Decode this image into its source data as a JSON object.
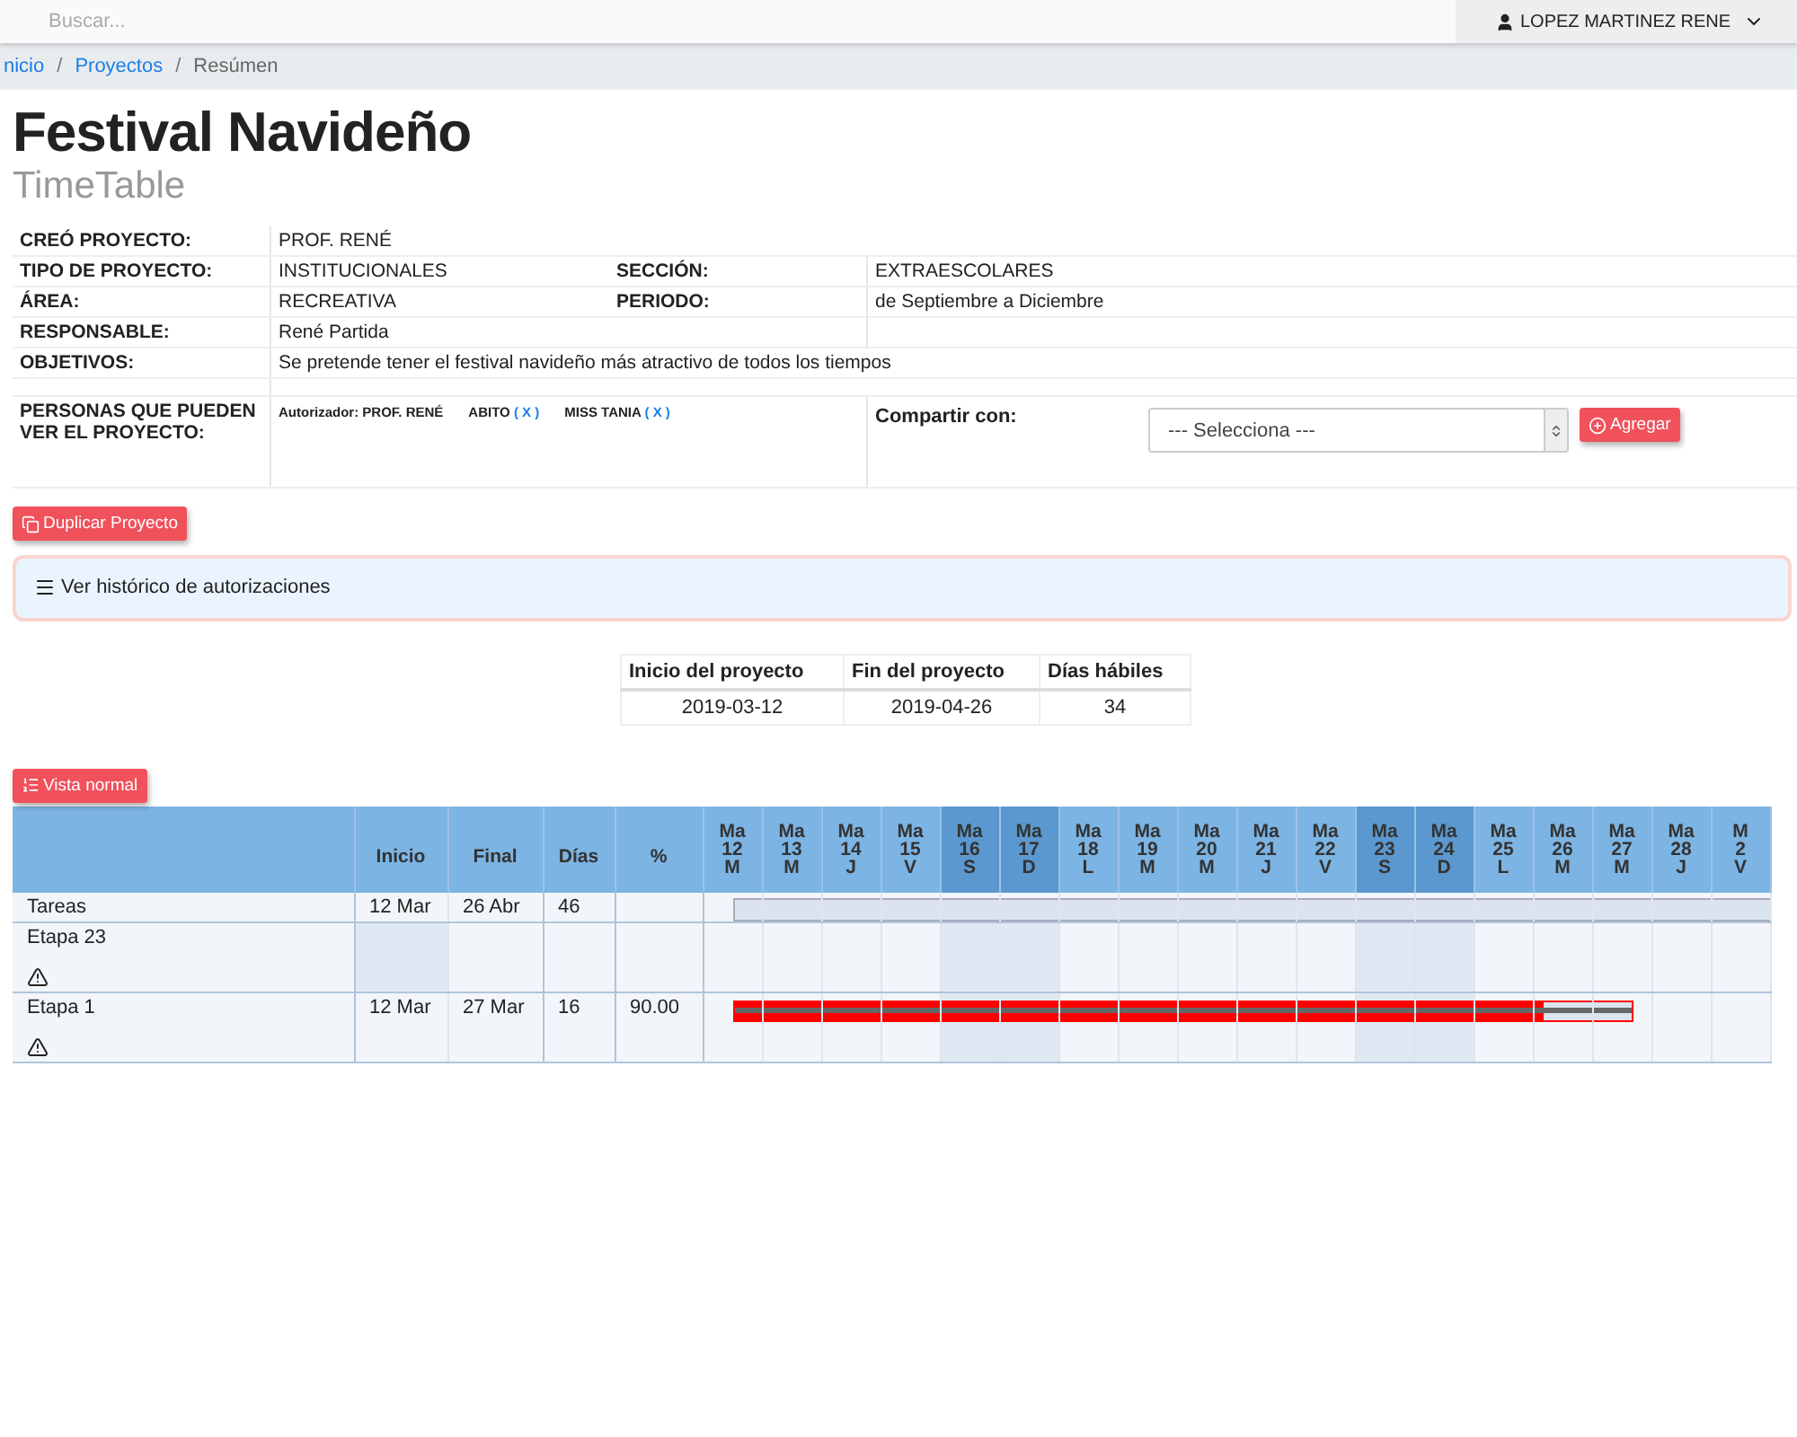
{
  "topbar": {
    "search": {
      "placeholder": "Buscar..."
    },
    "user": "LOPEZ MARTINEZ RENE"
  },
  "breadcrumb": [
    {
      "label": "nicio",
      "link": true
    },
    {
      "separator": "/",
      "label": "Proyectos",
      "link": true
    },
    {
      "separator": "/",
      "label": "Resúmen",
      "link": false
    }
  ],
  "title": "Festival Navideño",
  "subtitle": "TimeTable",
  "info": {
    "rows": [
      {
        "cells": [
          {
            "label": "CREÓ PROYECTO:",
            "value": "PROF. RENÉ"
          }
        ]
      },
      {
        "cells": [
          {
            "label": "TIPO DE PROYECTO:",
            "value": "INSTITUCIONALES"
          },
          {
            "label": "SECCIÓN:",
            "value": "EXTRAESCOLARES"
          }
        ]
      },
      {
        "cells": [
          {
            "label": "ÁREA:",
            "value": "RECREATIVA"
          },
          {
            "label": "PERIODO:",
            "value": "de Septiembre a Diciembre"
          }
        ]
      },
      {
        "cells": [
          {
            "label": "RESPONSABLE:",
            "value": "René Partida"
          },
          {}
        ]
      },
      {
        "cells": [
          {
            "label": "OBJETIVOS:",
            "value": "Se pretende tener el festival navideño más atractivo de todos los tiempos"
          }
        ]
      }
    ],
    "people": {
      "label": "PERSONAS QUE PUEDEN VER EL PROYECTO:",
      "items": [
        {
          "name": "Autorizador: PROF. RENÉ"
        },
        {
          "name": "ABITO",
          "remove": "( X )"
        },
        {
          "name": "MISS TANIA",
          "remove": "( X )"
        }
      ],
      "share_label": "Compartir con:",
      "select": "--- Selecciona ---",
      "add_button": "Agregar"
    }
  },
  "duplicate_button": "Duplicar Proyecto",
  "history": "Ver histórico de autorizaciones",
  "summary": {
    "columns": [
      "Inicio del proyecto",
      "Fin del proyecto",
      "Días hábiles"
    ],
    "values": [
      "2019-03-12",
      "2019-04-26",
      "34"
    ]
  },
  "view_button": "Vista normal",
  "gantt": {
    "columns": [
      "Inicio",
      "Final",
      "Días",
      "%"
    ],
    "days": [
      {
        "month": "Ma",
        "day": "12",
        "weekday": "M",
        "weekend": false
      },
      {
        "month": "Ma",
        "day": "13",
        "weekday": "M",
        "weekend": false
      },
      {
        "month": "Ma",
        "day": "14",
        "weekday": "J",
        "weekend": false
      },
      {
        "month": "Ma",
        "day": "15",
        "weekday": "V",
        "weekend": false
      },
      {
        "month": "Ma",
        "day": "16",
        "weekday": "S",
        "weekend": true
      },
      {
        "month": "Ma",
        "day": "17",
        "weekday": "D",
        "weekend": true
      },
      {
        "month": "Ma",
        "day": "18",
        "weekday": "L",
        "weekend": false
      },
      {
        "month": "Ma",
        "day": "19",
        "weekday": "M",
        "weekend": false
      },
      {
        "month": "Ma",
        "day": "20",
        "weekday": "M",
        "weekend": false
      },
      {
        "month": "Ma",
        "day": "21",
        "weekday": "J",
        "weekend": false
      },
      {
        "month": "Ma",
        "day": "22",
        "weekday": "V",
        "weekend": false
      },
      {
        "month": "Ma",
        "day": "23",
        "weekday": "S",
        "weekend": true
      },
      {
        "month": "Ma",
        "day": "24",
        "weekday": "D",
        "weekend": true
      },
      {
        "month": "Ma",
        "day": "25",
        "weekday": "L",
        "weekend": false
      },
      {
        "month": "Ma",
        "day": "26",
        "weekday": "M",
        "weekend": false
      },
      {
        "month": "Ma",
        "day": "27",
        "weekday": "M",
        "weekend": false
      },
      {
        "month": "Ma",
        "day": "28",
        "weekday": "J",
        "weekend": false
      },
      {
        "month": "M",
        "day": "2",
        "weekday": "V",
        "weekend": false
      }
    ],
    "rows": [
      {
        "kind": "summary",
        "name": "Tareas",
        "start": "12 Mar",
        "end": "26 Abr",
        "days": "46",
        "warning": false,
        "span": [
          true,
          true,
          true,
          true,
          true,
          true,
          true,
          true,
          true,
          true,
          true,
          true,
          true,
          true,
          true,
          true,
          true,
          true
        ]
      },
      {
        "kind": "task",
        "name": "Etapa 23",
        "warning": true,
        "span": [
          false,
          false,
          false,
          false,
          false,
          false,
          false,
          false,
          false,
          false,
          false,
          false,
          false,
          false,
          false,
          false,
          false,
          false
        ]
      },
      {
        "kind": "task",
        "name": "Etapa 1",
        "start": "12 Mar",
        "end": "27 Mar",
        "days": "16",
        "percent": "90.00",
        "warning": true,
        "level": 0.9,
        "span": [
          true,
          true,
          true,
          true,
          true,
          true,
          true,
          true,
          true,
          true,
          true,
          true,
          true,
          true,
          true,
          true,
          false,
          false
        ]
      }
    ]
  }
}
